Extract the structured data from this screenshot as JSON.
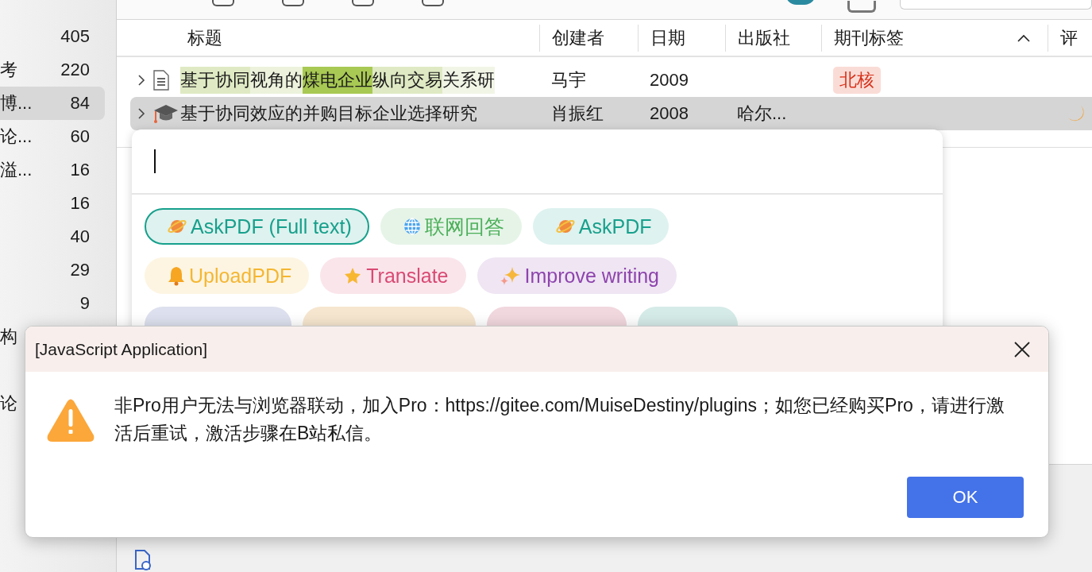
{
  "sidebar": {
    "items": [
      {
        "count": "405",
        "selected": false
      },
      {
        "label": "考",
        "count": "220",
        "selected": false
      },
      {
        "label": "博...",
        "count": "84",
        "selected": true
      },
      {
        "label": "论...",
        "count": "60",
        "selected": false
      },
      {
        "label": "溢...",
        "count": "16",
        "selected": false
      },
      {
        "count": "16",
        "selected": false
      },
      {
        "count": "40",
        "selected": false
      },
      {
        "count": "29",
        "selected": false
      },
      {
        "count": "9",
        "selected": false
      },
      {
        "label": "构",
        "selected": false
      }
    ],
    "more_items": [
      {
        "label": "论",
        "selected": false
      }
    ]
  },
  "table": {
    "columns": [
      "标题",
      "创建者",
      "日期",
      "出版社",
      "期刊标签",
      "评"
    ],
    "rows": [
      {
        "kind": "document",
        "selected": false,
        "title": [
          {
            "text": "基于协同",
            "color": "#dfeac4"
          },
          {
            "text": "视角的",
            "color": "#ecf2dc"
          },
          {
            "text": "煤电企业",
            "color": "#a8c953"
          },
          {
            "text": "纵向交易",
            "color": "#dfeac4"
          },
          {
            "text": "关系研",
            "color": "#f1f5e6"
          }
        ],
        "creator": "马宇",
        "date": "2009",
        "tag": "北核",
        "rating": false
      },
      {
        "kind": "thesis",
        "selected": true,
        "title": [
          {
            "text": "基于协同效应的并购目标企业选择研究"
          }
        ],
        "creator": "肖振红",
        "date": "2008",
        "publisher": "哈尔...",
        "rating": true
      }
    ]
  },
  "popup": {
    "chip_rows": [
      [
        {
          "label": "AskPDF (Full text)",
          "color": "#17a08c",
          "selected": true
        },
        {
          "label": "联网回答",
          "color": "#4caf5a",
          "selected": false
        },
        {
          "label": "AskPDF",
          "color": "#17a08c",
          "selected": false
        }
      ],
      [
        {
          "label": "UploadPDF",
          "color": "#f4b632",
          "selected": false
        },
        {
          "label": "Translate",
          "color": "#d94a74",
          "selected": false
        },
        {
          "label": "Improve writing",
          "color": "#8e44ad",
          "selected": false
        }
      ],
      [
        {
          "color": "#dde0ee",
          "selected": false
        },
        {
          "color": "#f6e6cf",
          "selected": false
        },
        {
          "color": "#f1d7de",
          "selected": false
        },
        {
          "color": "#d5ebe8",
          "selected": false
        }
      ]
    ]
  },
  "dialog": {
    "title": "[JavaScript Application]",
    "message": "非Pro用户无法与浏览器联动，加入Pro：https://gitee.com/MuiseDestiny/plugins；如您已经购买Pro，请进行激活后重试，激活步骤在B站私信。",
    "button": "OK"
  }
}
